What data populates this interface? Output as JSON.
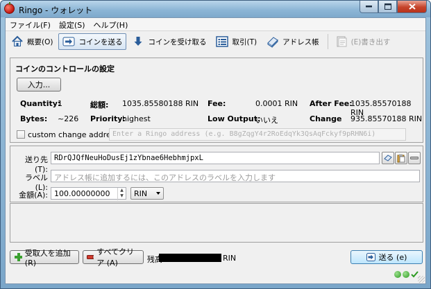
{
  "window": {
    "title": "Ringo - ウォレット",
    "buttons": [
      "minimize",
      "maximize",
      "close"
    ]
  },
  "menu": [
    "ファイル(F)",
    "設定(S)",
    "ヘルプ(H)"
  ],
  "toolbar": [
    {
      "label": "概要(O)",
      "icon": "home-icon"
    },
    {
      "label": "コインを送る",
      "icon": "send-arrow-icon",
      "active": true
    },
    {
      "label": "コインを受け取る",
      "icon": "receive-arrow-icon"
    },
    {
      "label": "取引(T)",
      "icon": "list-icon"
    },
    {
      "label": "アドレス帳",
      "icon": "address-book-icon"
    },
    {
      "label": "(E)書き出す",
      "icon": "export-icon",
      "disabled": true
    }
  ],
  "coin_control": {
    "title": "コインのコントロールの設定",
    "inputs_button": "入力...",
    "quantity_label": "Quantity:",
    "quantity_value": "1",
    "bytes_label": "Bytes:",
    "bytes_value": "~226",
    "amount_label": "総額:",
    "amount_value": "1035.85580188 RIN",
    "priority_label": "Priority:",
    "priority_value": "highest",
    "fee_label": "Fee:",
    "fee_value": "0.0001 RIN",
    "low_output_label": "Low Output:",
    "low_output_value": "いいえ",
    "after_fee_label": "After Fee:",
    "after_fee_value": "1035.85570188 RIN",
    "change_label": "Change",
    "change_value": "935.85570188 RIN",
    "custom_change_label": "custom change address",
    "custom_change_placeholder": "Enter a Ringo address (e.g. B8gZqgY4r2RoEdqYk3QsAqFckyf9pRHN6i)"
  },
  "recipient": {
    "pay_to_label": "送り先(T):",
    "pay_to_value": "RDrQJQfNeuHoDusEj1zYbnae6HebhmjpxL",
    "label_label": "ラベル(L):",
    "label_placeholder": "アドレス帳に追加するには、このアドレスのラベルを入力します",
    "amount_label": "金額(A):",
    "amount_value": "100.00000000",
    "unit": "RIN"
  },
  "bottom": {
    "add_recipient": "受取人を追加 (R)",
    "clear_all": "すべてクリア (A)",
    "balance_label": "残高:",
    "balance_unit": "RIN",
    "send": "送る (e)"
  },
  "colors": {
    "titlebar": "#8db6d6",
    "client_bg": "#f0f0f0",
    "send_button": "#bee6fd"
  }
}
